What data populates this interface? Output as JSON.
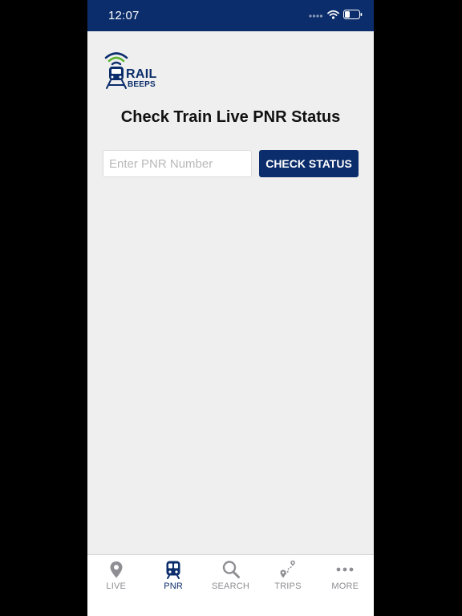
{
  "status_bar": {
    "time": "12:07",
    "background_color": "#0b2d6b",
    "icons": [
      "signal-dots-icon",
      "wifi-icon",
      "battery-icon"
    ]
  },
  "logo": {
    "text_line1": "RAIL",
    "text_line2": "BEEPS",
    "brand_color": "#0b2d6b",
    "signal_color": "#5cb531"
  },
  "main": {
    "title": "Check Train Live PNR Status",
    "pnr_input": {
      "value": "",
      "placeholder": "Enter PNR Number"
    },
    "check_button_label": "CHECK STATUS"
  },
  "tab_bar": {
    "active_color": "#0b2d6b",
    "inactive_color": "#8e8e93",
    "tabs": [
      {
        "label": "LIVE",
        "icon": "map-pin-icon",
        "active": false
      },
      {
        "label": "PNR",
        "icon": "train-icon",
        "active": true
      },
      {
        "label": "SEARCH",
        "icon": "search-icon",
        "active": false
      },
      {
        "label": "TRIPS",
        "icon": "route-icon",
        "active": false
      },
      {
        "label": "MORE",
        "icon": "more-icon",
        "active": false
      }
    ]
  }
}
